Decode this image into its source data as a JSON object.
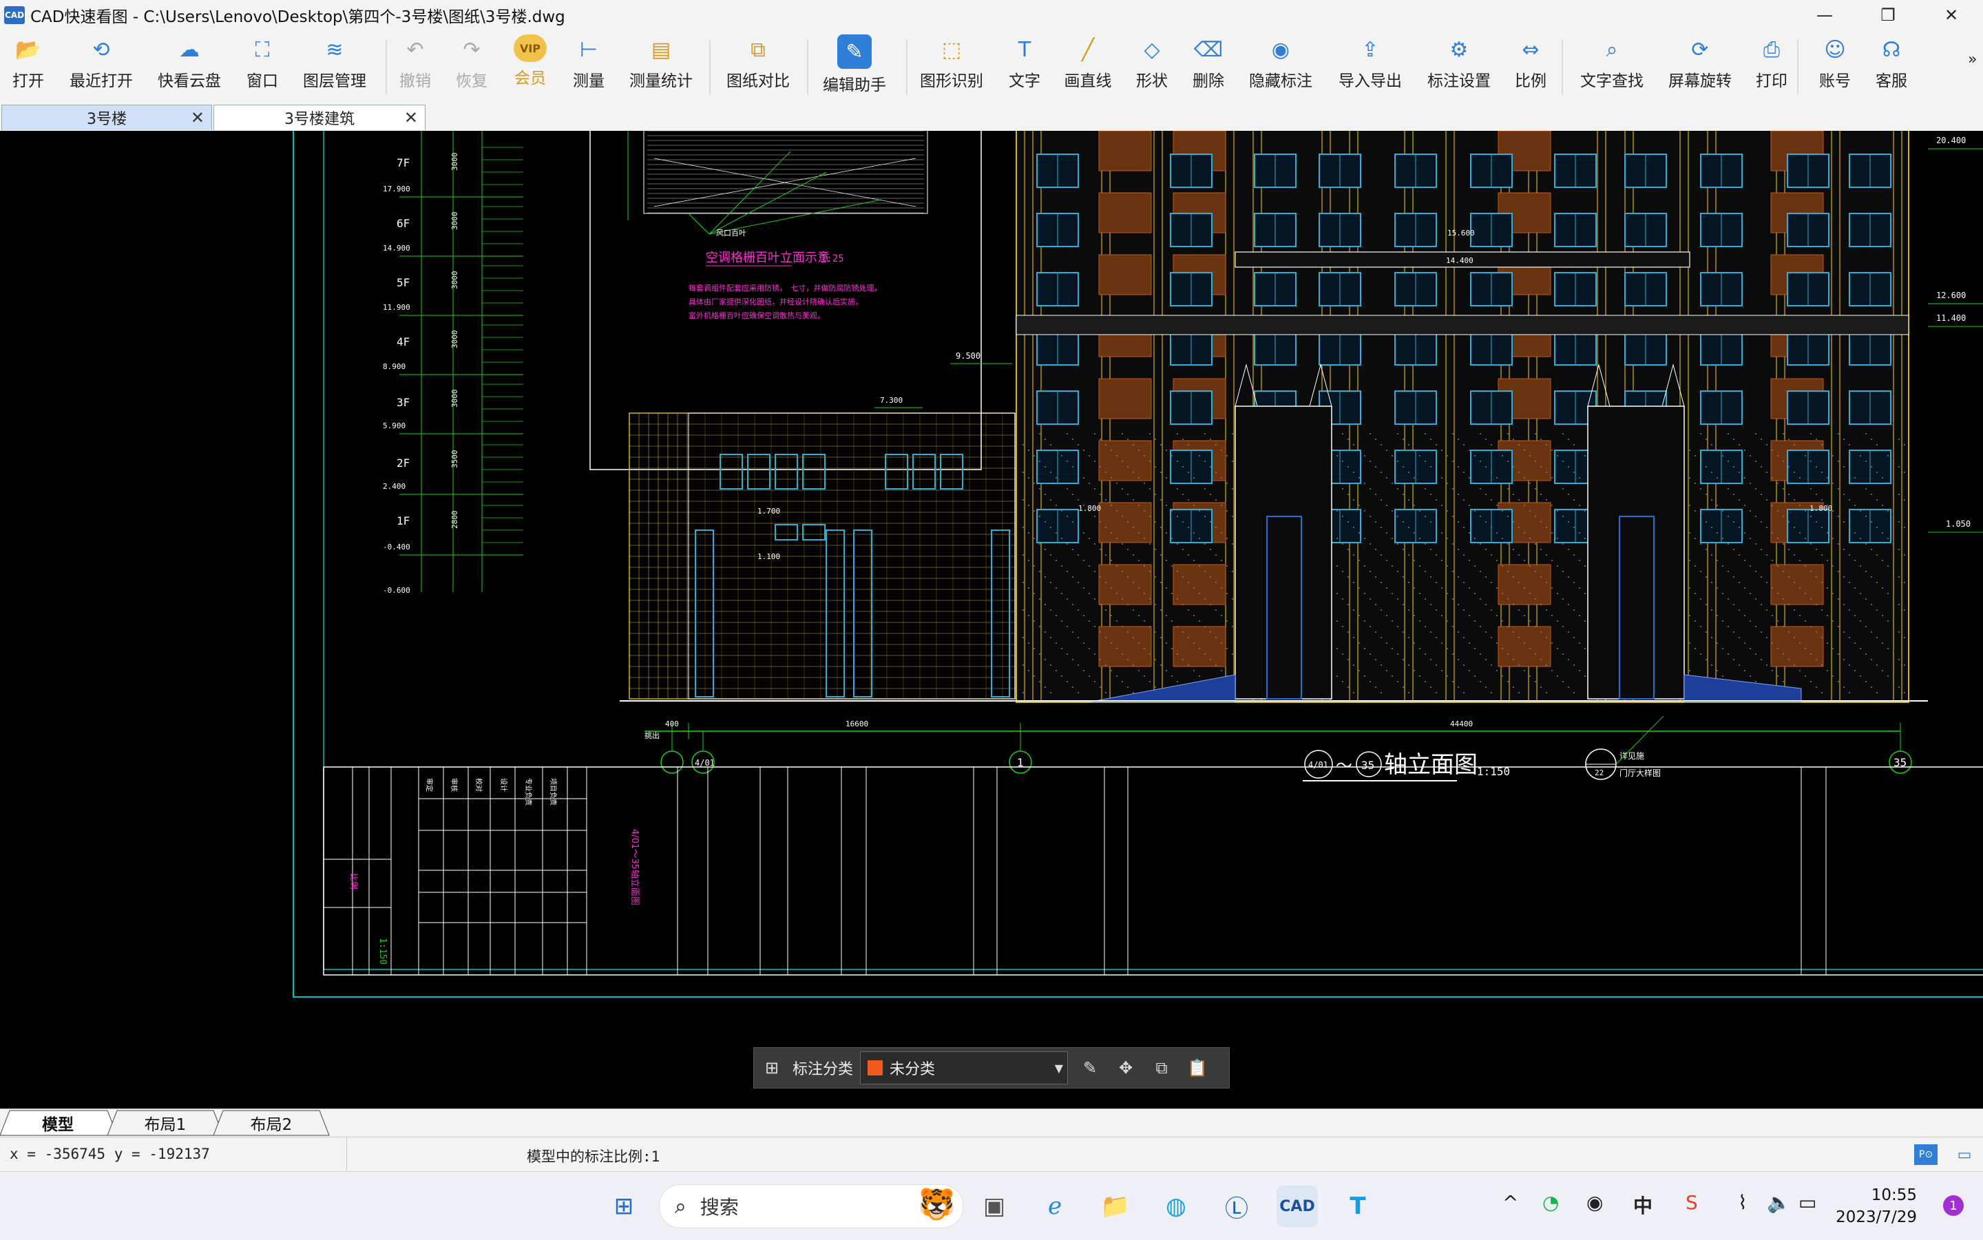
{
  "window": {
    "logo": "CAD",
    "title": "CAD快速看图 - C:\\Users\\Lenovo\\Desktop\\第四个-3号楼\\图纸\\3号楼.dwg",
    "controls": {
      "minimize": "—",
      "maximize": "❐",
      "close": "✕"
    }
  },
  "toolbar": {
    "items": [
      {
        "label": "打开",
        "icon": "folder-open-icon",
        "glyph": "📂"
      },
      {
        "label": "最近打开",
        "icon": "recent-icon",
        "glyph": "⟲"
      },
      {
        "label": "快看云盘",
        "icon": "cloud-icon",
        "glyph": "☁"
      },
      {
        "label": "窗口",
        "icon": "window-icon",
        "glyph": "⛶"
      },
      {
        "label": "图层管理",
        "icon": "layers-icon",
        "glyph": "≋"
      },
      {
        "label": "撤销",
        "icon": "undo-icon",
        "glyph": "↶",
        "disabled": true
      },
      {
        "label": "恢复",
        "icon": "redo-icon",
        "glyph": "↷",
        "disabled": true
      },
      {
        "label": "会员",
        "icon": "vip-icon",
        "glyph": "VIP",
        "vip": true
      },
      {
        "label": "测量",
        "icon": "measure-icon",
        "glyph": "⊢"
      },
      {
        "label": "测量统计",
        "icon": "measure-stats-icon",
        "glyph": "▤"
      },
      {
        "label": "图纸对比",
        "icon": "compare-icon",
        "glyph": "⧉"
      },
      {
        "label": "编辑助手",
        "icon": "edit-assistant-icon",
        "glyph": "✎"
      },
      {
        "label": "图形识别",
        "icon": "shape-recognize-icon",
        "glyph": "⬚"
      },
      {
        "label": "文字",
        "icon": "text-icon",
        "glyph": "T"
      },
      {
        "label": "画直线",
        "icon": "line-icon",
        "glyph": "╱"
      },
      {
        "label": "形状",
        "icon": "shapes-icon",
        "glyph": "◇"
      },
      {
        "label": "删除",
        "icon": "eraser-icon",
        "glyph": "⌫"
      },
      {
        "label": "隐藏标注",
        "icon": "hide-icon",
        "glyph": "◉"
      },
      {
        "label": "导入导出",
        "icon": "import-export-icon",
        "glyph": "⇪"
      },
      {
        "label": "标注设置",
        "icon": "annotation-settings-icon",
        "glyph": "⚙"
      },
      {
        "label": "比例",
        "icon": "scale-icon",
        "glyph": "⇔"
      },
      {
        "label": "文字查找",
        "icon": "text-search-icon",
        "glyph": "⌕"
      },
      {
        "label": "屏幕旋转",
        "icon": "rotate-icon",
        "glyph": "⟳"
      },
      {
        "label": "打印",
        "icon": "print-icon",
        "glyph": "⎙"
      },
      {
        "label": "账号",
        "icon": "account-icon",
        "glyph": "☺"
      },
      {
        "label": "客服",
        "icon": "headset-icon",
        "glyph": "☊"
      }
    ],
    "more": "»"
  },
  "doc_tabs": [
    {
      "label": "3号楼",
      "active": true,
      "close": "✕"
    },
    {
      "label": "3号楼建筑",
      "active": false,
      "close": "✕"
    }
  ],
  "drawing": {
    "floors": [
      {
        "name": "7F",
        "elev": "17.900"
      },
      {
        "name": "6F",
        "elev": "14.900"
      },
      {
        "name": "5F",
        "elev": "11.900"
      },
      {
        "name": "4F",
        "elev": "8.900"
      },
      {
        "name": "3F",
        "elev": "5.900"
      },
      {
        "name": "2F",
        "elev": "2.400"
      },
      {
        "name": "1F",
        "elev": "-0.400"
      }
    ],
    "base_elev": "-0.600",
    "dims_left": [
      "3000",
      "3000",
      "3000",
      "3000",
      "3000",
      "3500",
      "2800"
    ],
    "detail_title": "空调格栅百叶立面示意",
    "detail_scale": "1:25",
    "detail_notes": [
      "每套调组件配套应采用防锈，　七寸，并做防腐防锈处理，",
      "具体由厂家提供深化图纸，并经设计院确认后实施，",
      "室外机格栅百叶应确保空调散热与美观。"
    ],
    "elevations": {
      "top_right": "20.400",
      "mid_right_1": "12.600",
      "mid_right_2": "11.400",
      "canopy_1": "15.600",
      "canopy_2": "14.400",
      "annex_roof": "9.500",
      "annex_top": "7.300",
      "annex_mid": "1.700",
      "annex_low": "1.100",
      "entry_left": "1.800",
      "entry_right": "1.800",
      "ground_right": "1.050"
    },
    "axis_dims": {
      "left": "400",
      "middle": "16600",
      "right": "44400"
    },
    "axes": {
      "a1": "4/01",
      "a2": "1",
      "a3": "35",
      "a4": "4/01"
    },
    "view_title": "4/01～35轴立面图",
    "view_title_text": "轴立面图",
    "view_title_a": "4/01",
    "view_title_b": "35",
    "view_scale": "1:150",
    "callout_label": "详见施",
    "callout_num": "22",
    "callout_sub": "门厅大样图",
    "titleblock": {
      "scale_label": "比例",
      "scale": "1:150",
      "drawing_no": "4/01～35轴立面图",
      "sign_cells": [
        "审定",
        "审核",
        "校对",
        "设计",
        "专业负责",
        "项目负责"
      ]
    }
  },
  "annotation_bar": {
    "label": "标注分类",
    "selected": "未分类",
    "swatch_color": "#f05a1a"
  },
  "layout_tabs": [
    "模型",
    "布局1",
    "布局2"
  ],
  "status": {
    "coords": "x = -356745  y = -192137",
    "scale_text": "模型中的标注比例:1"
  },
  "taskbar": {
    "search_placeholder": "搜索",
    "ime": "中",
    "time": "10:55",
    "date": "2023/7/29",
    "notifications": "1"
  },
  "colors": {
    "cad_bg": "#000000",
    "cyan": "#00c0c0",
    "green": "#19d219",
    "yellow": "#d8b020",
    "magenta": "#ff2bd6",
    "orange": "#c25a1a",
    "blue": "#2070d0",
    "white": "#ffffff",
    "accent": "#2f7fd8"
  }
}
